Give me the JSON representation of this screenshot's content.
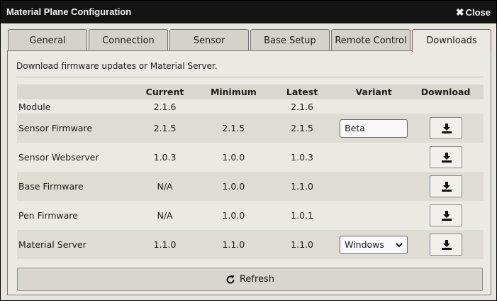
{
  "window": {
    "title": "Material Plane Configuration",
    "close_label": "Close"
  },
  "tabs": [
    {
      "label": "General"
    },
    {
      "label": "Connection"
    },
    {
      "label": "Sensor"
    },
    {
      "label": "Base Setup"
    },
    {
      "label": "Remote Control"
    },
    {
      "label": "Downloads",
      "active": true
    }
  ],
  "downloads": {
    "description": "Download firmware updates or Material Server.",
    "columns": {
      "name": "",
      "current": "Current",
      "minimum": "Minimum",
      "latest": "Latest",
      "variant": "Variant",
      "download": "Download"
    },
    "rows": [
      {
        "name": "Module",
        "current": "2.1.6",
        "minimum": "",
        "latest": "2.1.6"
      },
      {
        "name": "Sensor Firmware",
        "current": "2.1.5",
        "minimum": "2.1.5",
        "latest": "2.1.5",
        "variant": "Beta"
      },
      {
        "name": "Sensor Webserver",
        "current": "1.0.3",
        "minimum": "1.0.0",
        "latest": "1.0.3"
      },
      {
        "name": "Base Firmware",
        "current": "N/A",
        "minimum": "1.0.0",
        "latest": "1.1.0"
      },
      {
        "name": "Pen Firmware",
        "current": "N/A",
        "minimum": "1.0.0",
        "latest": "1.0.1"
      },
      {
        "name": "Material Server",
        "current": "1.1.0",
        "minimum": "1.1.0",
        "latest": "1.1.0",
        "variant": "Windows"
      }
    ],
    "refresh_label": "Refresh"
  },
  "icons": {
    "close": "close-x-icon",
    "download": "download-icon",
    "refresh": "refresh-icon",
    "select": "chevron-down-icon"
  },
  "colors": {
    "titlebar": "#141414",
    "active_tab_border": "#b24a4a",
    "panel_bg": "#ebeae2",
    "row_shade": "#dedcd3"
  }
}
